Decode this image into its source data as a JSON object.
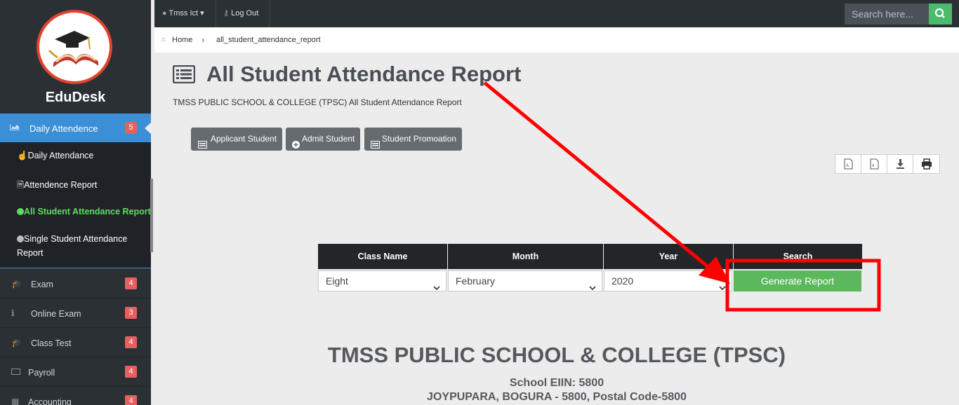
{
  "sidebar": {
    "brand": "EduDesk",
    "active_menu": {
      "label": "Daily Attendence",
      "badge": "5",
      "icon": "area-chart-icon"
    },
    "submenu": [
      {
        "label": "Daily Attendance",
        "icon": "hand-pointer-icon"
      },
      {
        "label": "Attendence Report",
        "icon": "file-icon"
      },
      {
        "label": "All Student Attendance Report",
        "icon": "circle-icon",
        "active": true
      },
      {
        "label": "Single Student Attendance",
        "label2": "Report",
        "icon": "circle-icon"
      }
    ],
    "menu": [
      {
        "label": "Exam",
        "badge": "4",
        "icon": "graduation-cap-icon"
      },
      {
        "label": "Online Exam",
        "badge": "3",
        "icon": "info-icon"
      },
      {
        "label": "Class Test",
        "badge": "4",
        "icon": "graduation-cap-icon"
      },
      {
        "label": "Payroll",
        "badge": "4",
        "icon": "money-icon"
      },
      {
        "label": "Accounting",
        "badge": "4",
        "icon": "calculator-icon"
      }
    ]
  },
  "topbar": {
    "user_label": "Tmss Ict",
    "logout_label": "Log Out",
    "search_placeholder": "Search here..."
  },
  "breadcrumb": {
    "home": "Home",
    "current": "all_student_attendance_report"
  },
  "page": {
    "title": "All Student Attendance Report",
    "subtitle": "TMSS PUBLIC SCHOOL & COLLEGE (TPSC) All Student Attendance Report",
    "buttons": [
      "Applicant Student",
      "Admit Student",
      "Student Promoation"
    ]
  },
  "form": {
    "headers": [
      "Class Name",
      "Month",
      "Year",
      "Search"
    ],
    "class_value": "Eight",
    "month_value": "February",
    "year_value": "2020",
    "generate_label": "Generate Report"
  },
  "school": {
    "name": "TMSS PUBLIC SCHOOL & COLLEGE (TPSC)",
    "eiin": "School EIIN: 5800",
    "address": "JOYPUPARA, BOGURA - 5800, Postal Code-5800"
  },
  "colors": {
    "accent": "#3b8fd6",
    "badge": "#e95f5f",
    "success": "#5cb85c",
    "annotation": "#ff0000"
  }
}
